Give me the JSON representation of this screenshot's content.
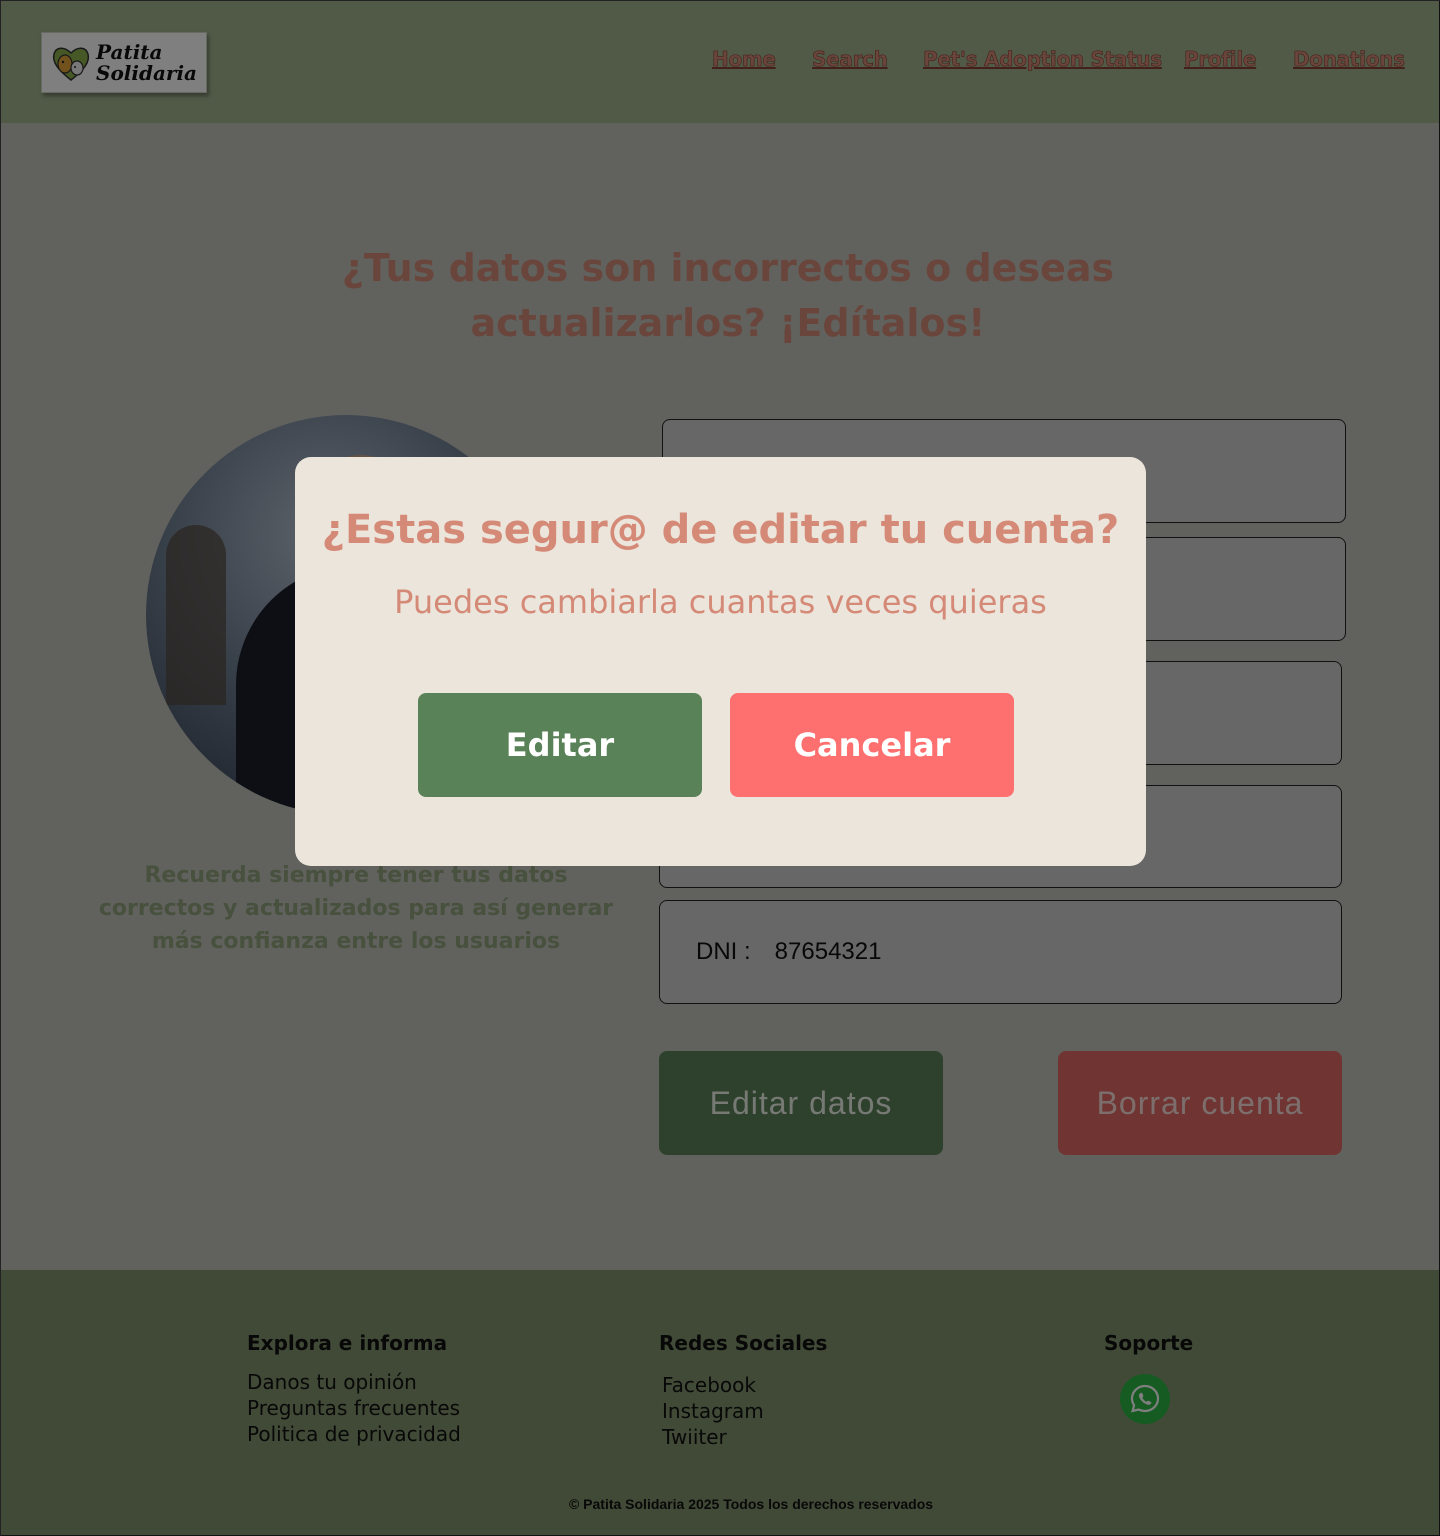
{
  "header": {
    "logo": {
      "line1": "Patita",
      "line2": "Solidaria"
    },
    "nav": [
      {
        "label": "Home"
      },
      {
        "label": "Search"
      },
      {
        "label": "Pet's Adoption Status"
      },
      {
        "label": "Profile"
      },
      {
        "label": "Donations"
      }
    ]
  },
  "main": {
    "title": "¿Tus datos son incorrectos o deseas actualizarlos? ¡Edítalos!",
    "reminder": "Recuerda siempre tener tus datos correctos y actualizados para así generar más confianza entre los usuarios",
    "fields": [
      {
        "label": "",
        "value": ""
      },
      {
        "label": "",
        "value": ""
      },
      {
        "label": "",
        "value": ""
      },
      {
        "label": "",
        "value": ""
      },
      {
        "label": "DNI :",
        "value": "87654321"
      }
    ],
    "edit_button": "Editar datos",
    "delete_button": "Borrar cuenta"
  },
  "footer": {
    "explore": {
      "heading": "Explora e informa",
      "links": [
        "Danos tu opinión",
        "Preguntas frecuentes",
        "Politica de privacidad"
      ]
    },
    "social": {
      "heading": "Redes Sociales",
      "links": [
        "Facebook",
        "Instagram",
        "Twiiter"
      ]
    },
    "support": {
      "heading": "Soporte",
      "icon": "whatsapp-icon"
    },
    "copyright": "© Patita Solidaria 2025 Todos los derechos reservados"
  },
  "modal": {
    "title": "¿Estas segur@ de editar tu cuenta?",
    "subtitle": "Puedes cambiarla cuantas veces quieras",
    "confirm_label": "Editar",
    "cancel_label": "Cancelar"
  },
  "colors": {
    "header_bg": "#a2b38f",
    "accent_text": "#d58a78",
    "primary_button": "#5a8258",
    "danger_button": "#fe6f6f",
    "footer_bg": "#80956d",
    "modal_bg": "#ece5db"
  }
}
